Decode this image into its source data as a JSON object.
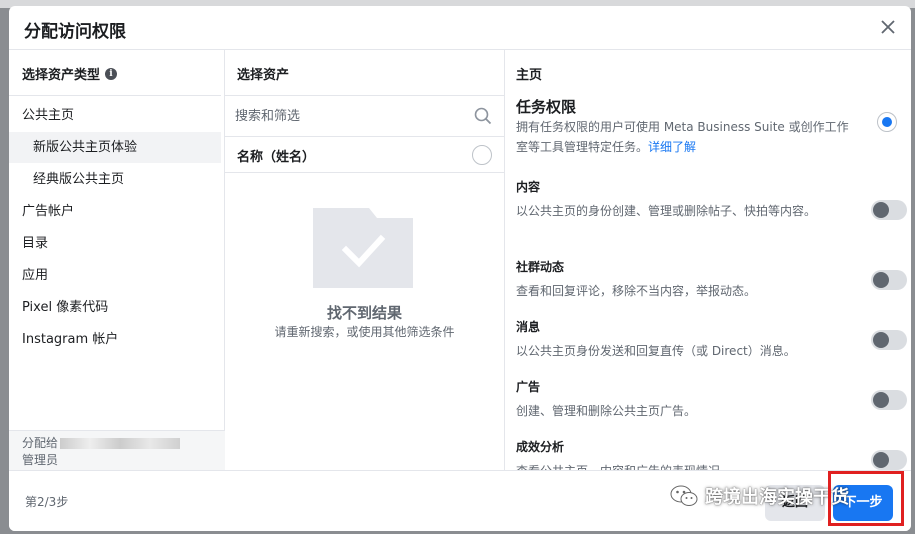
{
  "modal": {
    "title": "分配访问权限"
  },
  "asset_types": {
    "heading": "选择资产类型",
    "items": [
      {
        "label": "公共主页"
      },
      {
        "label": "新版公共主页体验"
      },
      {
        "label": "经典版公共主页"
      },
      {
        "label": "广告帐户"
      },
      {
        "label": "目录"
      },
      {
        "label": "应用"
      },
      {
        "label": "Pixel 像素代码"
      },
      {
        "label": "Instagram 帐户"
      }
    ],
    "footer_line1": "分配给",
    "footer_line2": "管理员"
  },
  "assets": {
    "heading": "选择资产",
    "search_placeholder": "搜索和筛选",
    "name_column": "名称（姓名）",
    "empty_title": "找不到结果",
    "empty_subtitle": "请重新搜索，或使用其他筛选条件"
  },
  "permissions": {
    "section": "主页",
    "main_title": "任务权限",
    "main_desc": "拥有任务权限的用户可使用 Meta Business Suite 或创作工作室等工具管理特定任务。",
    "main_link": "详细了解",
    "tasks": [
      {
        "name": "内容",
        "desc": "以公共主页的身份创建、管理或删除帖子、快拍等内容。"
      },
      {
        "name": "社群动态",
        "desc": "查看和回复评论，移除不当内容，举报动态。"
      },
      {
        "name": "消息",
        "desc": "以公共主页身份发送和回复直传（或 Direct）消息。"
      },
      {
        "name": "广告",
        "desc": "创建、管理和删除公共主页广告。"
      },
      {
        "name": "成效分析",
        "desc": "查看公共主页、内容和广告的表现情况。"
      }
    ]
  },
  "footer": {
    "step": "第2/3步",
    "back_label": "返回",
    "next_label": "下一步",
    "watermark": "跨境出海实操干货"
  },
  "colors": {
    "accent": "#1877f2",
    "highlight": "#e02020"
  }
}
